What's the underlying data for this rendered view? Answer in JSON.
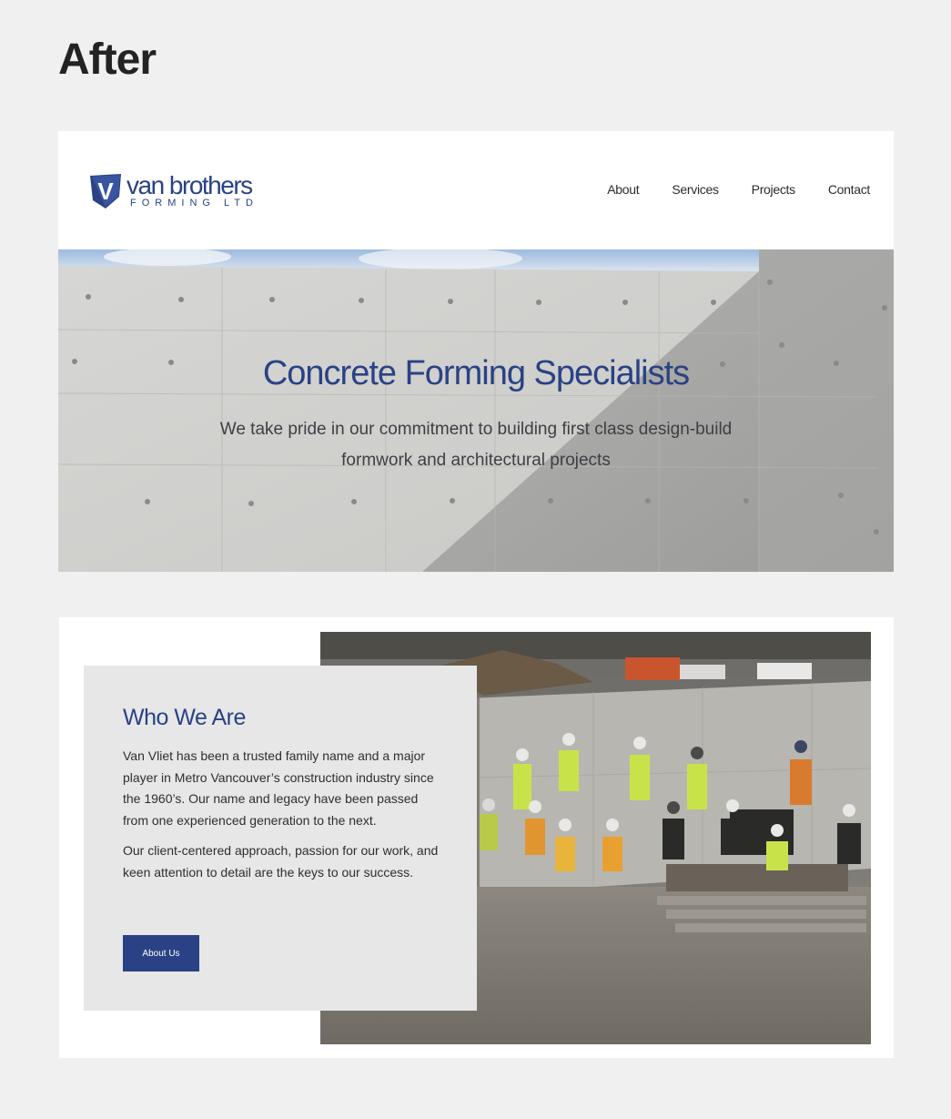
{
  "page_label": "After",
  "header": {
    "logo": {
      "mark": "V",
      "wordmark": "van brothers",
      "subline": "FORMING LTD"
    },
    "nav": [
      "About",
      "Services",
      "Projects",
      "Contact"
    ]
  },
  "hero": {
    "title": "Concrete Forming Specialists",
    "subtitle": "We take pride in our commitment to building first class design-build formwork and architectural projects",
    "background": "concrete-wall-photo"
  },
  "about": {
    "title": "Who We Are",
    "paragraph1": "Van Vliet has been a trusted family name and a major player in Metro Vancouver’s construction industry since the 1960’s. Our name and legacy have been passed from one experienced generation to the next.",
    "paragraph2": "Our client-centered approach, passion for our work, and keen attention to detail are the keys to our success.",
    "button_label": "About Us",
    "photo": "team-on-construction-site-photo"
  },
  "colors": {
    "brand": "#2a4285",
    "page_bg": "#f0f0f0",
    "panel": "#e7e7e7"
  }
}
